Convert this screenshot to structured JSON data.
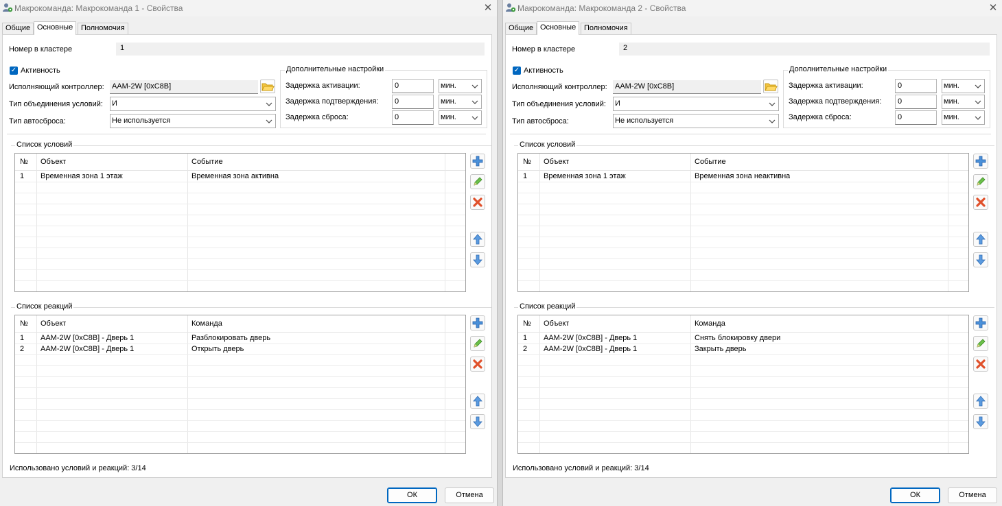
{
  "windows": [
    {
      "title": "Макрокоманда: Макрокоманда 1 - Свойства",
      "tabs": [
        "Общие",
        "Основные",
        "Полномочия"
      ],
      "cluster": {
        "label": "Номер в кластере",
        "value": "1"
      },
      "active": {
        "label": "Активность",
        "checked": true
      },
      "controller": {
        "label": "Исполняющий контроллер:",
        "value": "AAM-2W [0xC8B]"
      },
      "condition_type": {
        "label": "Тип объединения условий:",
        "value": "И"
      },
      "autoreset": {
        "label": "Тип автосброса:",
        "value": "Не используется"
      },
      "extra": {
        "title": "Дополнительные настройки",
        "rows": [
          {
            "label": "Задержка активации:",
            "value": "0",
            "unit": "мин."
          },
          {
            "label": "Задержка подтверждения:",
            "value": "0",
            "unit": "мин."
          },
          {
            "label": "Задержка сброса:",
            "value": "0",
            "unit": "мин."
          }
        ]
      },
      "conditions": {
        "title": "Список условий",
        "headers": [
          "№",
          "Объект",
          "Событие"
        ],
        "rows": [
          [
            "1",
            "Временная зона 1 этаж",
            "Временная зона активна"
          ]
        ]
      },
      "reactions": {
        "title": "Список реакций",
        "headers": [
          "№",
          "Объект",
          "Команда"
        ],
        "rows": [
          [
            "1",
            "AAM-2W [0xC8B] - Дверь 1",
            "Разблокировать дверь"
          ],
          [
            "2",
            "AAM-2W [0xC8B] - Дверь 1",
            "Открыть дверь"
          ]
        ]
      },
      "usage": "Использовано условий и реакций: 3/14",
      "ok": "ОК",
      "cancel": "Отмена"
    },
    {
      "title": "Макрокоманда: Макрокоманда 2 - Свойства",
      "tabs": [
        "Общие",
        "Основные",
        "Полномочия"
      ],
      "cluster": {
        "label": "Номер в кластере",
        "value": "2"
      },
      "active": {
        "label": "Активность",
        "checked": true
      },
      "controller": {
        "label": "Исполняющий контроллер:",
        "value": "AAM-2W [0xC8B]"
      },
      "condition_type": {
        "label": "Тип объединения условий:",
        "value": "И"
      },
      "autoreset": {
        "label": "Тип автосброса:",
        "value": "Не используется"
      },
      "extra": {
        "title": "Дополнительные настройки",
        "rows": [
          {
            "label": "Задержка активации:",
            "value": "0",
            "unit": "мин."
          },
          {
            "label": "Задержка подтверждения:",
            "value": "0",
            "unit": "мин."
          },
          {
            "label": "Задержка сброса:",
            "value": "0",
            "unit": "мин."
          }
        ]
      },
      "conditions": {
        "title": "Список условий",
        "headers": [
          "№",
          "Объект",
          "Событие"
        ],
        "rows": [
          [
            "1",
            "Временная зона 1 этаж",
            "Временная зона неактивна"
          ]
        ]
      },
      "reactions": {
        "title": "Список реакций",
        "headers": [
          "№",
          "Объект",
          "Команда"
        ],
        "rows": [
          [
            "1",
            "AAM-2W [0xC8B] - Дверь 1",
            "Снять блокировку двери"
          ],
          [
            "2",
            "AAM-2W [0xC8B] - Дверь 1",
            "Закрыть дверь"
          ]
        ]
      },
      "usage": "Использовано условий и реакций: 3/14",
      "ok": "ОК",
      "cancel": "Отмена"
    }
  ]
}
